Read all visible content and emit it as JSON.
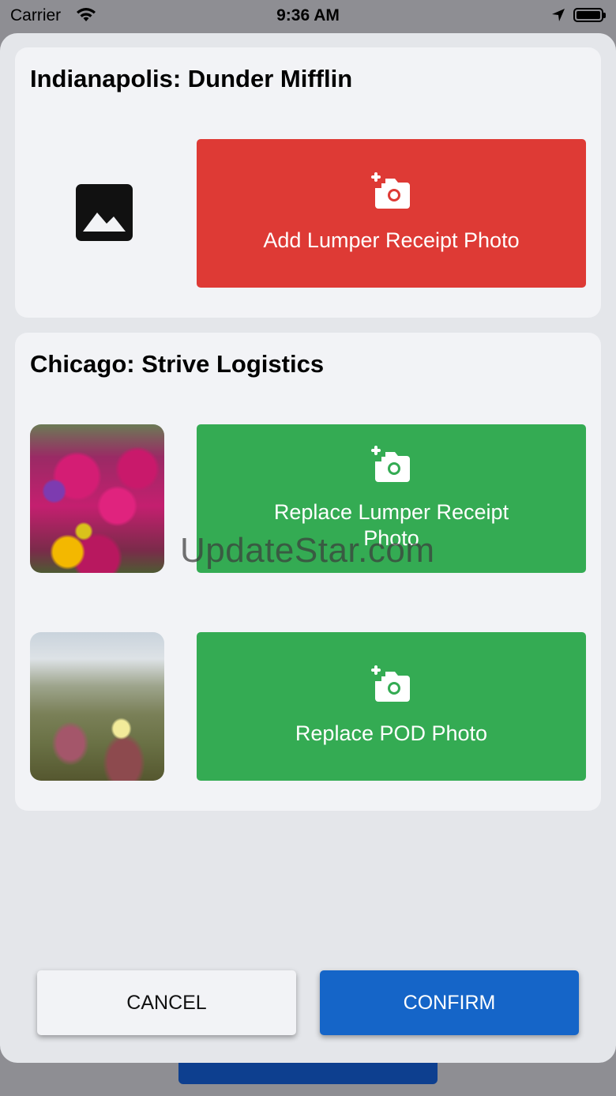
{
  "status_bar": {
    "carrier": "Carrier",
    "time": "9:36 AM",
    "wifi_icon": "wifi-icon",
    "location_icon": "location-arrow-icon",
    "battery_icon": "battery-icon"
  },
  "stops": [
    {
      "title": "Indianapolis: Dunder Mifflin",
      "photos": [
        {
          "thumbnail": "image-placeholder-icon",
          "action_label": "Add Lumper Receipt Photo",
          "action_color": "#de3a35",
          "action_icon": "add-photo-camera-icon"
        }
      ]
    },
    {
      "title": "Chicago: Strive Logistics",
      "photos": [
        {
          "thumbnail": "flowers-photo",
          "action_label": "Replace Lumper Receipt Photo",
          "action_color": "#34ab53",
          "action_icon": "add-photo-camera-icon"
        },
        {
          "thumbnail": "meadow-photo",
          "action_label": "Replace POD Photo",
          "action_color": "#34ab53",
          "action_icon": "add-photo-camera-icon"
        }
      ]
    }
  ],
  "watermark": "UpdateStar.com",
  "footer": {
    "cancel_label": "CANCEL",
    "confirm_label": "CONFIRM",
    "confirm_color": "#1565c8"
  }
}
